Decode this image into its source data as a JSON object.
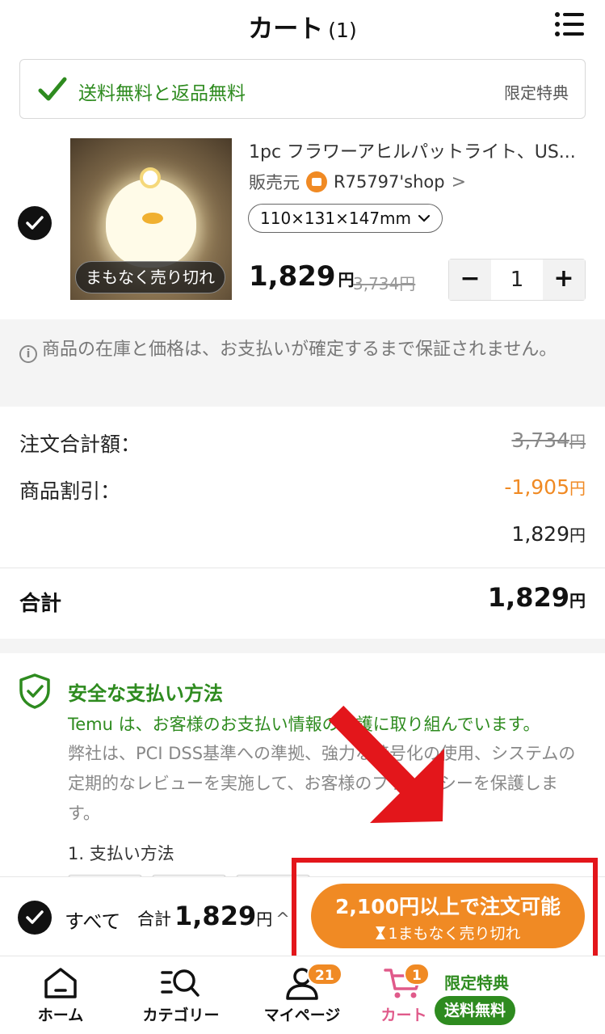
{
  "header": {
    "title": "カート",
    "count": "(1)",
    "menu_icon": "list-menu-icon"
  },
  "promo_banner": {
    "text": "送料無料と返品無料",
    "right_label": "限定特典",
    "icon": "check-icon",
    "color": "#2e8b1f"
  },
  "cart_item": {
    "checked": true,
    "badge": "まもなく売り切れ",
    "title": "1pc フラワーアヒルパットライト、US...",
    "seller_label": "販売元",
    "shop_name": "R75797'shop",
    "shop_chevron": ">",
    "variant": "110×131×147mm",
    "price": "1,829",
    "price_unit": "円",
    "original_price": "3,734円",
    "quantity": "1",
    "minus": "−",
    "plus": "+"
  },
  "notice": {
    "text": "商品の在庫と価格は、お支払いが確定するまで保証されません。"
  },
  "summary": {
    "order_total_label": "注文合計額：",
    "order_total_value": "3,734",
    "discount_label": "商品割引：",
    "discount_value": "-1,905",
    "subtotal_value": "1,829",
    "unit": "円",
    "total_label": "合計",
    "total_value": "1,829"
  },
  "secure": {
    "title": "安全な支払い方法",
    "line1": "Temu は、お客様のお支払い情報の保護に取り組んでいます。",
    "body": "弊社は、PCI DSS基準への準拠、強力な暗号化の使用、システムの定期的なレビューを実施して、お客様のプライバシーを保護します。",
    "payment_label": "1. 支払い方法"
  },
  "checkout": {
    "all_label": "すべて",
    "total_label": "合計",
    "total_value": "1,829",
    "unit": "円",
    "caret": "^",
    "button_main": "2,100円以上で注文可能",
    "button_sub": "1まもなく売り切れ",
    "button_color": "#f08a24"
  },
  "tabs": [
    {
      "label": "ホーム",
      "icon": "home-icon"
    },
    {
      "label": "カテゴリー",
      "icon": "category-search-icon"
    },
    {
      "label": "マイページ",
      "icon": "person-icon",
      "badge": "21"
    },
    {
      "label": "カート",
      "icon": "cart-icon",
      "badge": "1"
    }
  ],
  "promo_tab": {
    "title": "限定特典",
    "pill": "送料無料"
  },
  "colors": {
    "accent_orange": "#f08a24",
    "green": "#2e8b1f",
    "highlight_red": "#e3161b",
    "cart_pink": "#e05a8a"
  }
}
